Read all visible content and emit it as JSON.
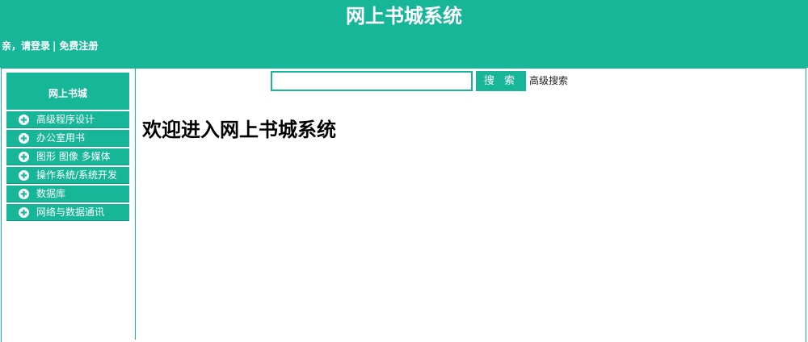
{
  "colors": {
    "primary": "#17b699",
    "header_text": "#ffffff",
    "body_text": "#000000"
  },
  "header": {
    "title": "网上书城系统",
    "login_link": "亲，请登录",
    "separator": "|",
    "register_link": "免费注册"
  },
  "search": {
    "value": "",
    "placeholder": "",
    "button_label": "搜 索",
    "advanced_link": "高级搜索"
  },
  "sidebar": {
    "title": "网上书城",
    "icon": "plus-circle-icon",
    "items": [
      {
        "label": "高级程序设计"
      },
      {
        "label": "办公室用书"
      },
      {
        "label": "图形 图像 多媒体"
      },
      {
        "label": "操作系统/系统开发"
      },
      {
        "label": "数据库"
      },
      {
        "label": "网络与数据通讯"
      }
    ]
  },
  "main": {
    "welcome": "欢迎进入网上书城系统"
  }
}
